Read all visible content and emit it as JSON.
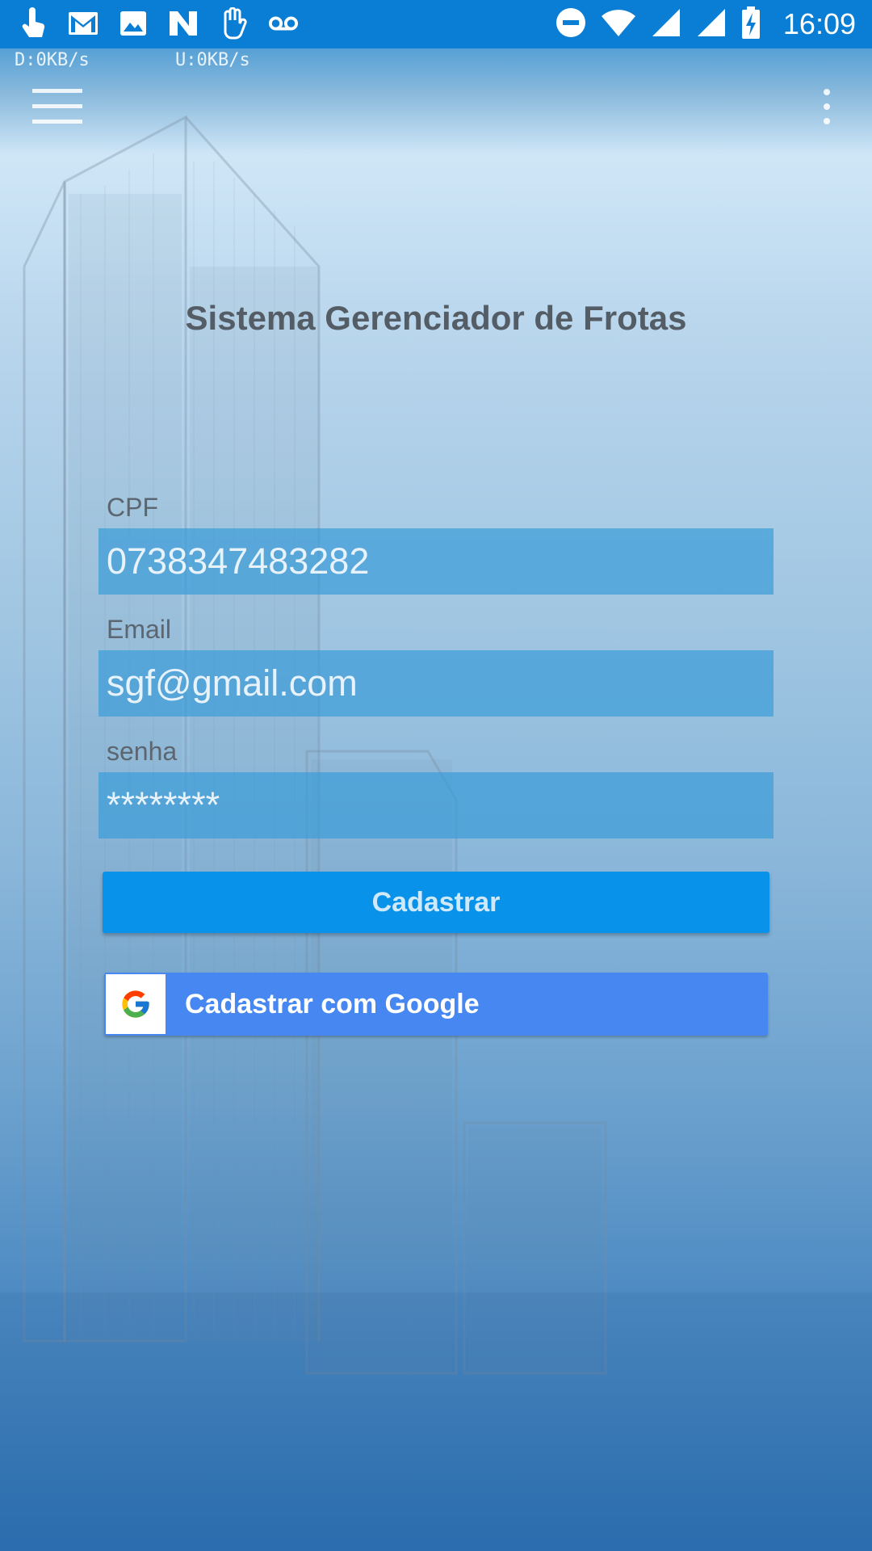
{
  "status_bar": {
    "time": "16:09",
    "left_icons": [
      "touch-icon",
      "gmail-icon",
      "image-icon",
      "n-app-icon",
      "hand-icon",
      "voicemail-icon"
    ],
    "right_icons": [
      "do-not-disturb-icon",
      "wifi-icon",
      "signal-icon",
      "signal-icon",
      "battery-charging-icon"
    ],
    "download_speed": "D:0KB/s",
    "upload_speed": "U:0KB/s"
  },
  "toolbar": {
    "menu_icon": "hamburger-menu-icon",
    "more_icon": "more-vert-icon"
  },
  "page": {
    "title": "Sistema Gerenciador de Frotas"
  },
  "form": {
    "cpf": {
      "label": "CPF",
      "value": "0738347483282"
    },
    "email": {
      "label": "Email",
      "value": "sgf@gmail.com"
    },
    "senha": {
      "label": "senha",
      "value": "********"
    }
  },
  "buttons": {
    "cadastrar": "Cadastrar",
    "google": "Cadastrar com Google"
  },
  "colors": {
    "status_bar": "#0a7ed4",
    "primary_button": "#0892e9",
    "google_button": "#4687f1",
    "field_background": "#3d9dd8",
    "title_text": "#545d66"
  }
}
